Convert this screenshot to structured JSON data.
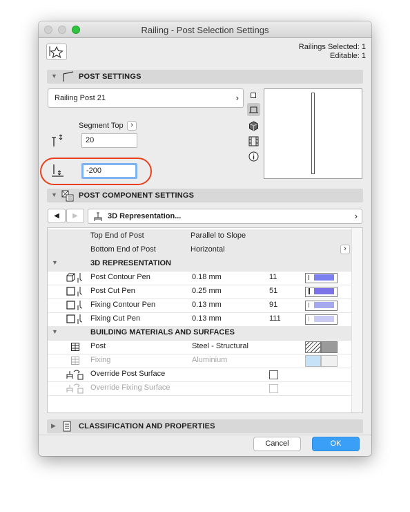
{
  "window": {
    "title": "Railing - Post Selection Settings"
  },
  "selection_info": {
    "selected": "Railings Selected: 1",
    "editable": "Editable: 1"
  },
  "post_settings": {
    "header": "POST SETTINGS",
    "post_name": "Railing Post 21",
    "segment_top_label": "Segment Top",
    "top_value": "20",
    "bottom_value": "-200"
  },
  "component_settings": {
    "header": "POST COMPONENT SETTINGS",
    "page_label": "3D Representation...",
    "rows": [
      {
        "label": "Top End of Post",
        "value": "Parallel to Slope"
      },
      {
        "label": "Bottom End of Post",
        "value": "Horizontal"
      }
    ],
    "representation_header": "3D REPRESENTATION",
    "pens": [
      {
        "label": "Post Contour Pen",
        "size": "0.18 mm",
        "number": "11",
        "color": "#7b7ff0"
      },
      {
        "label": "Post Cut Pen",
        "size": "0.25 mm",
        "number": "51",
        "color": "#7a72e6"
      },
      {
        "label": "Fixing Contour Pen",
        "size": "0.13 mm",
        "number": "91",
        "color": "#a7a9ee"
      },
      {
        "label": "Fixing Cut Pen",
        "size": "0.13 mm",
        "number": "111",
        "color": "#c9cbf5"
      }
    ],
    "materials_header": "BUILDING MATERIALS AND SURFACES",
    "materials": [
      {
        "label": "Post",
        "value": "Steel - Structural",
        "color": "#9a9a9a"
      },
      {
        "label": "Fixing",
        "value": "Aluminium",
        "color": "#c5e2f8"
      }
    ],
    "overrides": [
      {
        "label": "Override Post Surface"
      },
      {
        "label": "Override Fixing Surface"
      }
    ]
  },
  "classification": {
    "header": "CLASSIFICATION AND PROPERTIES"
  },
  "buttons": {
    "cancel": "Cancel",
    "ok": "OK"
  },
  "colors": {
    "ok_button": "#3a9ff6",
    "highlight_ring": "#e8401c",
    "focus_ring": "#7fb2f0"
  }
}
